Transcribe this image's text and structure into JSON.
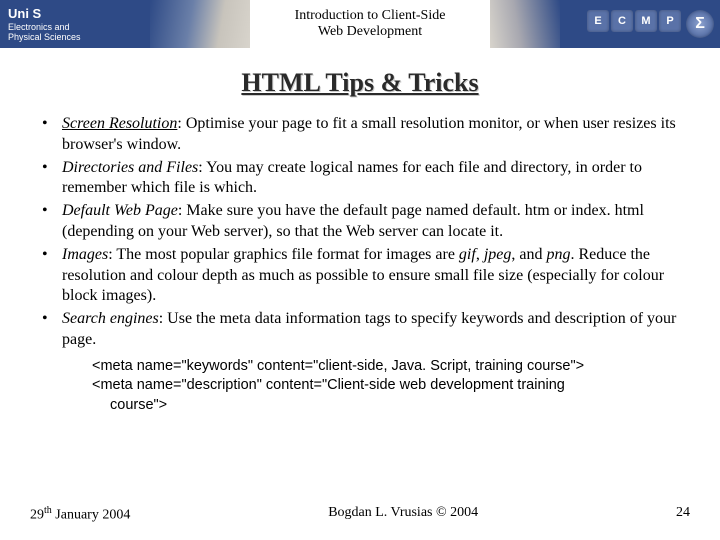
{
  "header": {
    "uni": "Uni S",
    "dept_line1": "Electronics and",
    "dept_line2": "Physical Sciences",
    "title_line1": "Introduction to Client-Side",
    "title_line2": "Web Development",
    "badges": [
      "E",
      "C",
      "M",
      "P"
    ],
    "sigma": "Σ"
  },
  "title": "HTML Tips & Tricks",
  "bullets": [
    {
      "term": "Screen Resolution",
      "underline": true,
      "text": ": Optimise your page to fit a small resolution monitor, or when user resizes its browser's window."
    },
    {
      "term": "Directories and Files",
      "underline": false,
      "text": ": You may create logical names for each file and directory, in order to remember which file is which."
    },
    {
      "term": "Default Web Page",
      "underline": false,
      "text": ": Make sure you have the default page named default. htm or index. html (depending on your Web server), so that the Web server can locate it."
    },
    {
      "term": "Images",
      "underline": false,
      "text_before": ": The most popular graphics file format for images are ",
      "italics": [
        "gif",
        "jpeg",
        "png"
      ],
      "joiners": [
        ", ",
        ", and "
      ],
      "text_after": ". Reduce the resolution and colour depth as much as possible to ensure small file size (especially for colour block images)."
    },
    {
      "term": "Search engines",
      "underline": false,
      "text": ": Use the meta data information tags to specify keywords and description of your page."
    }
  ],
  "code": {
    "line1": "<meta name=\"keywords\" content=\"client-side, Java. Script, training course\">",
    "line2a": "<meta name=\"description\" content=\"Client-side web development training",
    "line2b": "course\">"
  },
  "footer": {
    "date_day": "29",
    "date_sup": "th",
    "date_rest": " January 2004",
    "author": "Bogdan L. Vrusias © 2004",
    "page": "24"
  }
}
